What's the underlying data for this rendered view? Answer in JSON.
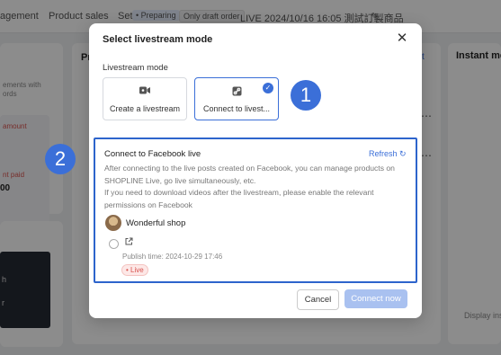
{
  "topbar": {
    "tab1": "agement",
    "tab2": "Product sales",
    "setting_prefix": "Set",
    "status_preparing": "• Preparing",
    "status_draft": "Only draft order",
    "live_title": "LIVE 2024/10/16 16:05 測試訂製商品"
  },
  "left_panel": {
    "line1": "ements with",
    "line2": "ords",
    "line3": "amount",
    "line4": "nt paid",
    "line5": "00",
    "dark_line1": "h",
    "dark_line2": "r"
  },
  "middle_panel": {
    "tab_label": "Pr",
    "link_label": "ct"
  },
  "right_panel": {
    "title": "Instant mes",
    "footer": "Display ins"
  },
  "modal": {
    "title": "Select livestream mode",
    "section_label": "Livestream mode",
    "options": [
      {
        "label": "Create a livestream",
        "icon": "video-camera-icon"
      },
      {
        "label": "Connect to livest...",
        "icon": "link-icon",
        "selected": true
      }
    ],
    "fb": {
      "title": "Connect to Facebook live",
      "refresh": "Refresh",
      "desc_line1": "After connecting to the live posts created on Facebook, you can manage products on",
      "desc_line2": "SHOPLINE Live, go live simultaneously, etc.",
      "desc_line3": "If you need to download videos after the livestream, please enable the relevant",
      "desc_line4": "permissions on Facebook",
      "shop_name": "Wonderful shop",
      "publish_time": "Publish time: 2024-10-29 17:46",
      "live_badge": "• Live"
    },
    "cancel": "Cancel",
    "connect": "Connect now"
  },
  "annotations": {
    "step1": "1",
    "step2": "2"
  },
  "colors": {
    "accent": "#3b6fd8",
    "highlight_border": "#2d64cc",
    "live_red": "#d9534f"
  }
}
